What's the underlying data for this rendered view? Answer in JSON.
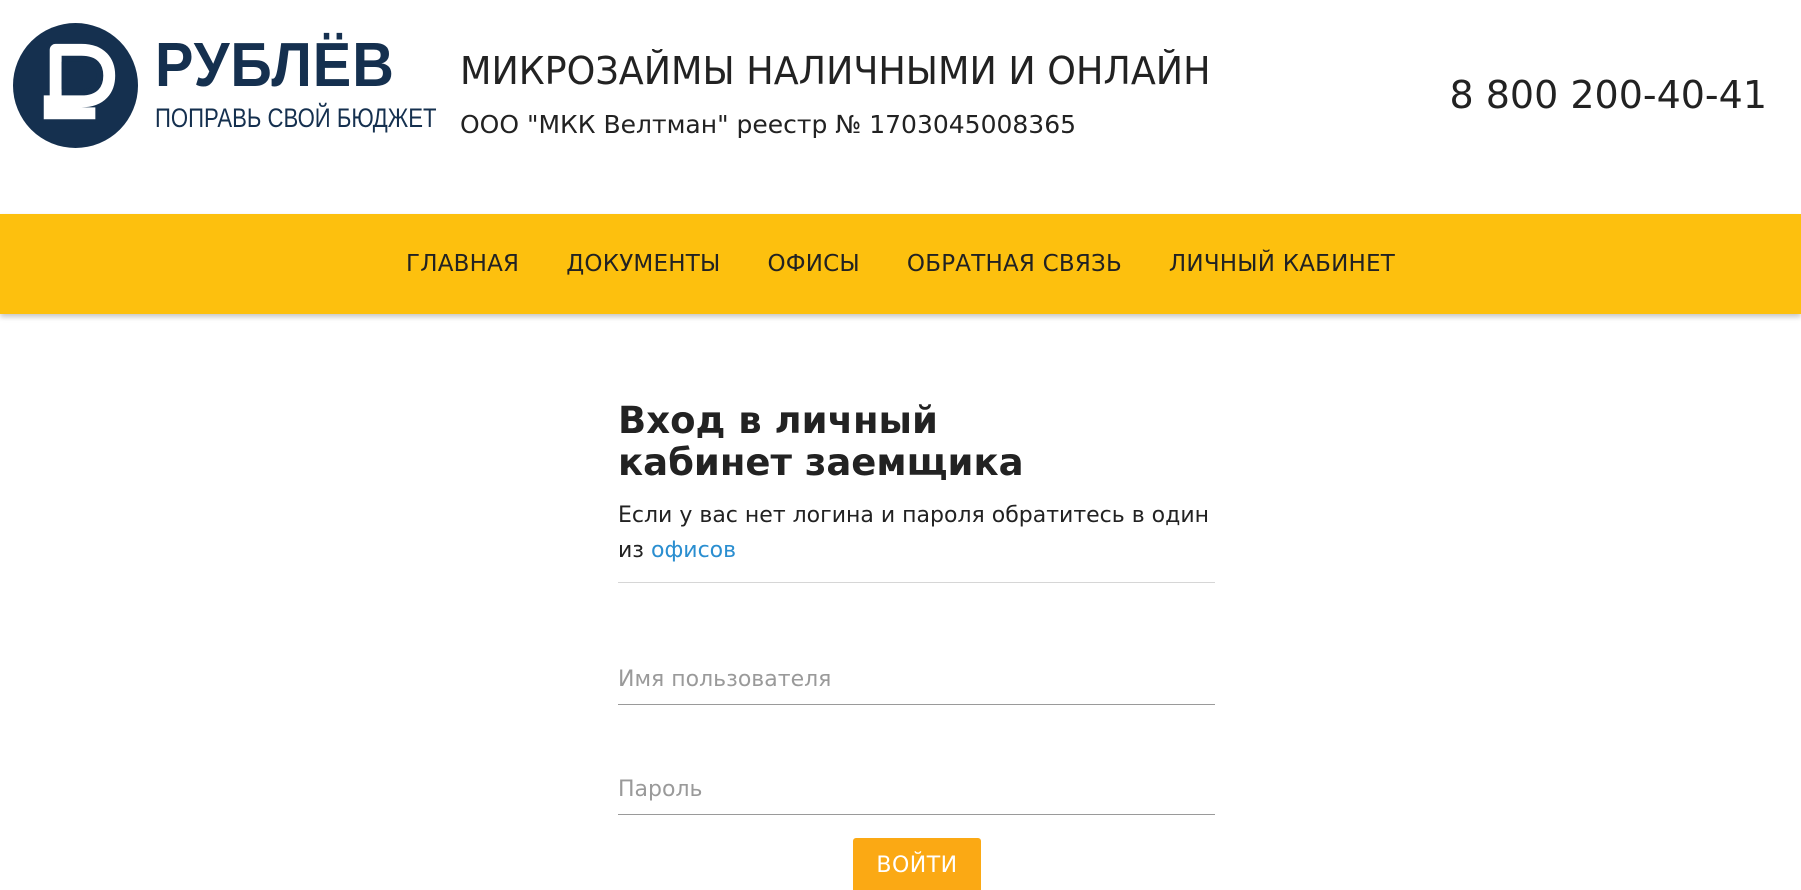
{
  "brand": {
    "name": "РУБЛЁВ",
    "slogan": "ПОПРАВЬ СВОЙ БЮДЖЕТ",
    "colors": {
      "primary": "#15304f",
      "accent": "#fdc00e",
      "button": "#fba914",
      "link": "#2a8ed0"
    }
  },
  "header": {
    "headline": "МИКРОЗАЙМЫ НАЛИЧНЫМИ И ОНЛАЙН",
    "registry": "ООО \"МКК Велтман\" реестр № 1703045008365",
    "phone": "8 800 200-40-41"
  },
  "nav": {
    "items": [
      {
        "label": "ГЛАВНАЯ"
      },
      {
        "label": "ДОКУМЕНТЫ"
      },
      {
        "label": "ОФИСЫ"
      },
      {
        "label": "ОБРАТНАЯ СВЯЗЬ"
      },
      {
        "label": "ЛИЧНЫЙ КАБИНЕТ"
      }
    ]
  },
  "login": {
    "title": "Вход в личный кабинет заемщика",
    "note": "Если у вас нет логина и пароля обратитесь в один из",
    "note_link": "офисов",
    "username_placeholder": "Имя пользователя",
    "password_placeholder": "Пароль",
    "submit_label": "ВОЙТИ"
  }
}
